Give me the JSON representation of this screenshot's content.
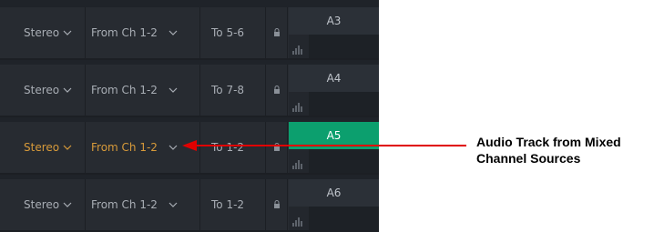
{
  "tracks": [
    {
      "format": "Stereo",
      "source": "From Ch 1-2",
      "dest": "To 5-6",
      "name": "A3",
      "selected": false
    },
    {
      "format": "Stereo",
      "source": "From Ch 1-2",
      "dest": "To 7-8",
      "name": "A4",
      "selected": false
    },
    {
      "format": "Stereo",
      "source": "From Ch 1-2",
      "dest": "To 1-2",
      "name": "A5",
      "selected": true
    },
    {
      "format": "Stereo",
      "source": "From Ch 1-2",
      "dest": "To 1-2",
      "name": "A6",
      "selected": false
    }
  ],
  "annotation": {
    "line1": "Audio Track from Mixed",
    "line2": "Channel Sources"
  },
  "colors": {
    "panel_bg": "#272b31",
    "active_text": "#d79a3a",
    "selected_track": "#0c9f6e",
    "arrow": "#e00000"
  },
  "icons": {
    "dropdown": "chevron-down-icon",
    "lock": "lock-icon",
    "meter": "audio-meter-icon"
  }
}
